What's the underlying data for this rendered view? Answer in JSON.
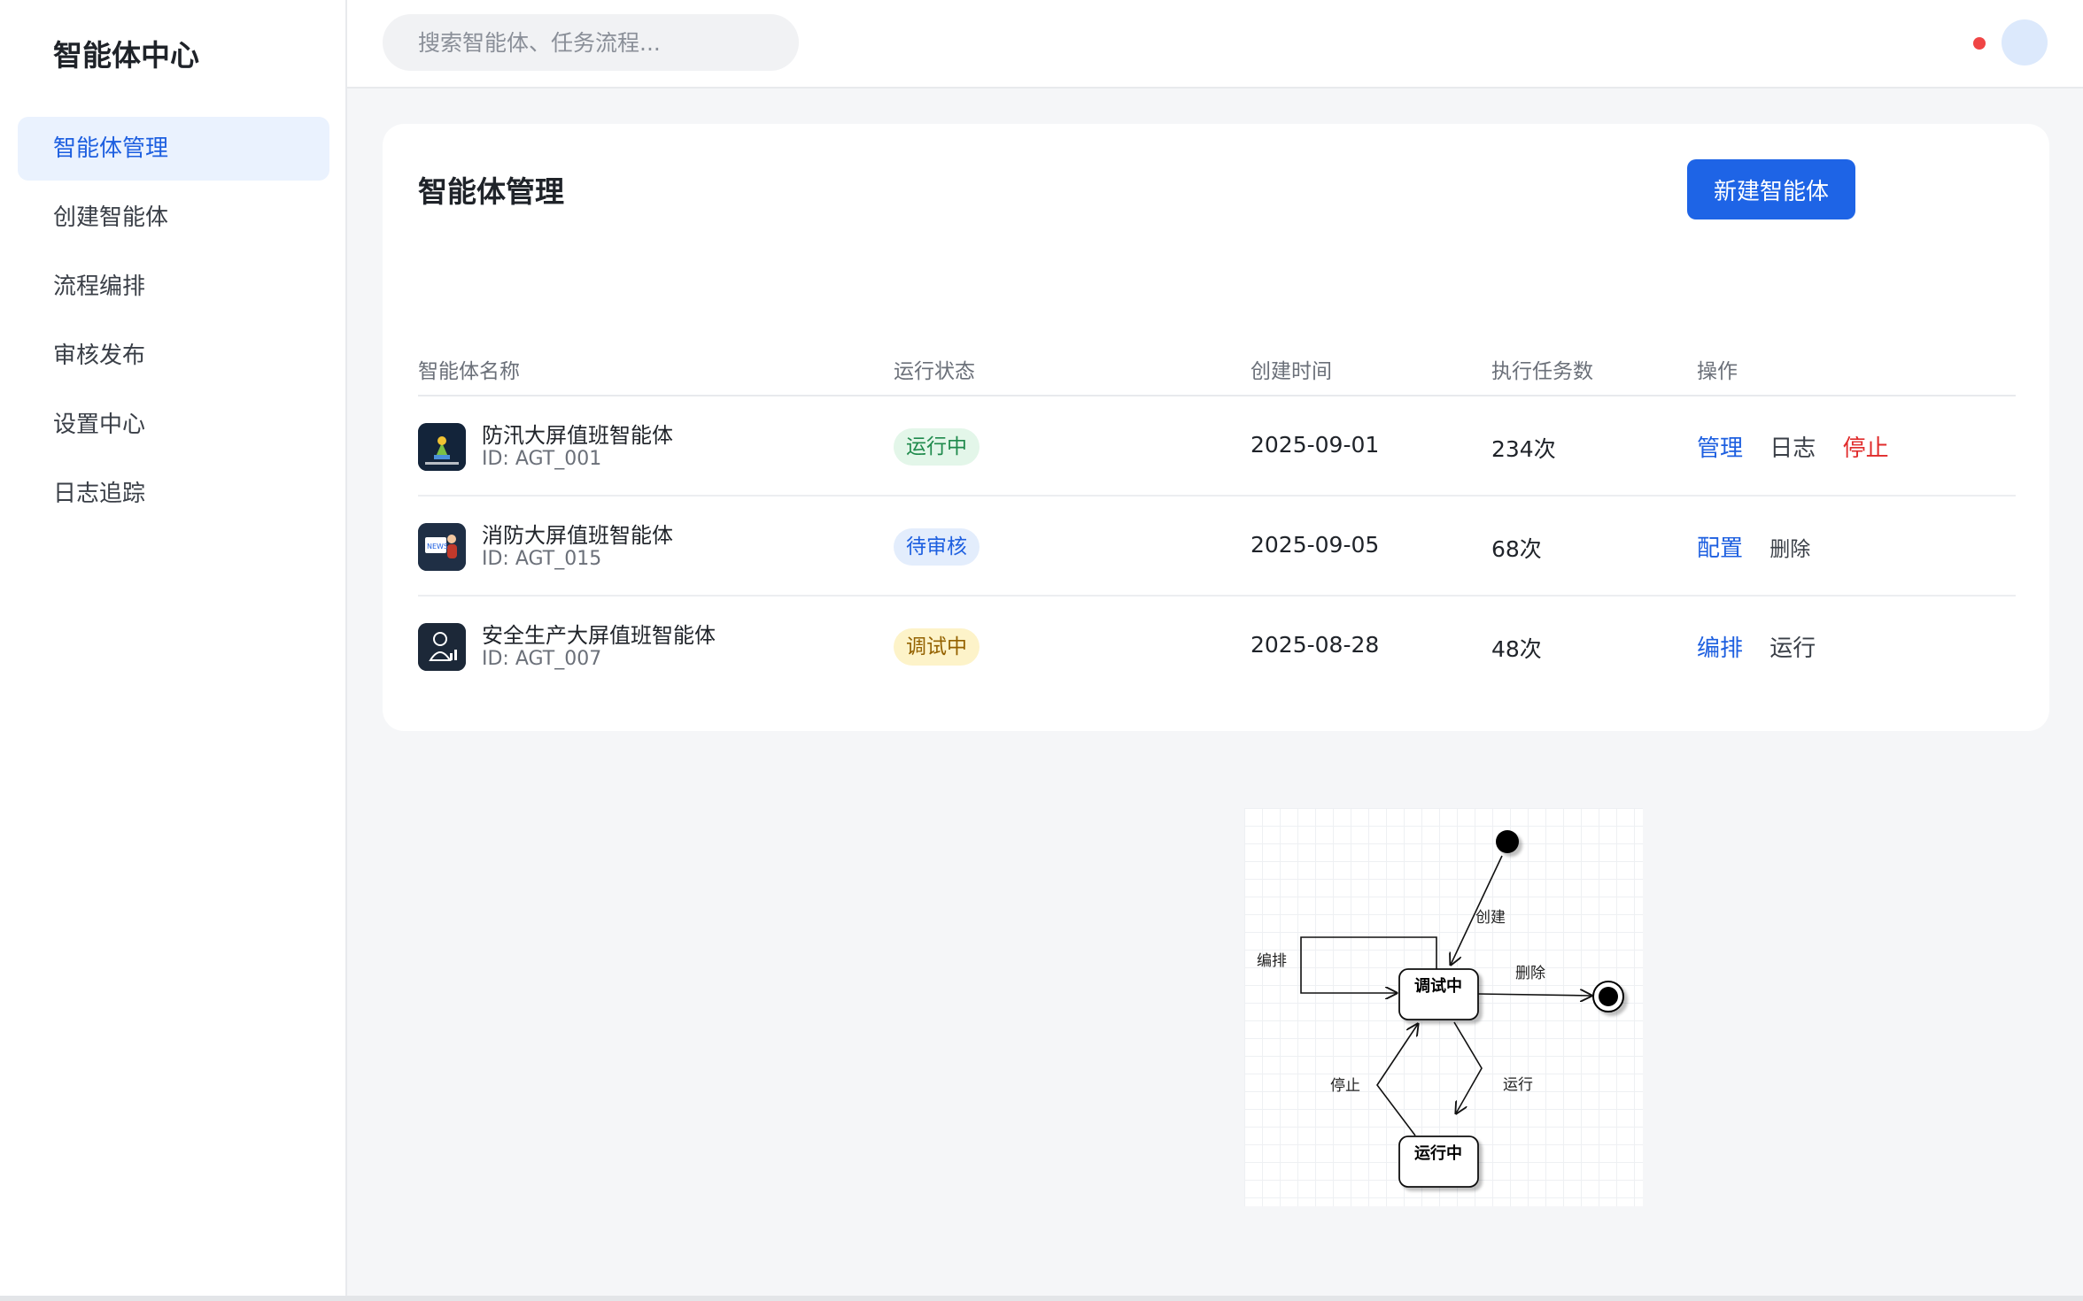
{
  "sidebar": {
    "brand": "智能体中心",
    "items": [
      {
        "label": "智能体管理",
        "active": true
      },
      {
        "label": "创建智能体"
      },
      {
        "label": "流程编排"
      },
      {
        "label": "审核发布"
      },
      {
        "label": "设置中心"
      },
      {
        "label": "日志追踪"
      }
    ]
  },
  "topbar": {
    "search_placeholder": "搜索智能体、任务流程...",
    "search_value": ""
  },
  "main": {
    "title": "智能体管理",
    "new_button": "新建智能体",
    "columns": [
      "智能体名称",
      "运行状态",
      "创建时间",
      "执行任务数",
      "操作"
    ],
    "rows": [
      {
        "name": "防汛大屏值班智能体",
        "id": "ID: AGT_001",
        "icon": "price-tracker-icon",
        "status": "运行中",
        "status_color": "#1f8a4c",
        "created": "2025-09-01",
        "tasks": "234次",
        "actions": [
          "管理",
          "日志",
          "停止"
        ]
      },
      {
        "name": "消防大屏值班智能体",
        "id": "ID: AGT_015",
        "icon": "news-reader-icon",
        "status": "待审核",
        "status_color": "#1d5fe0",
        "created": "2025-09-05",
        "tasks": "68次",
        "actions": [
          "配置",
          "删除"
        ]
      },
      {
        "name": "安全生产大屏值班智能体",
        "id": "ID: AGT_007",
        "icon": "astronaut-chart-icon",
        "status": "调试中",
        "status_color": "#946200",
        "created": "2025-08-28",
        "tasks": "48次",
        "actions": [
          "编排",
          "运行"
        ]
      }
    ]
  },
  "state_diagram": {
    "states": [
      "调试中",
      "运行中"
    ],
    "transitions": {
      "create": "创建",
      "arrange": "编排",
      "delete": "删除",
      "run": "运行",
      "stop": "停止"
    }
  },
  "colors": {
    "primary": "#1e64e6",
    "danger": "#e02b2b",
    "nav_active_bg": "#eaf2fe"
  }
}
